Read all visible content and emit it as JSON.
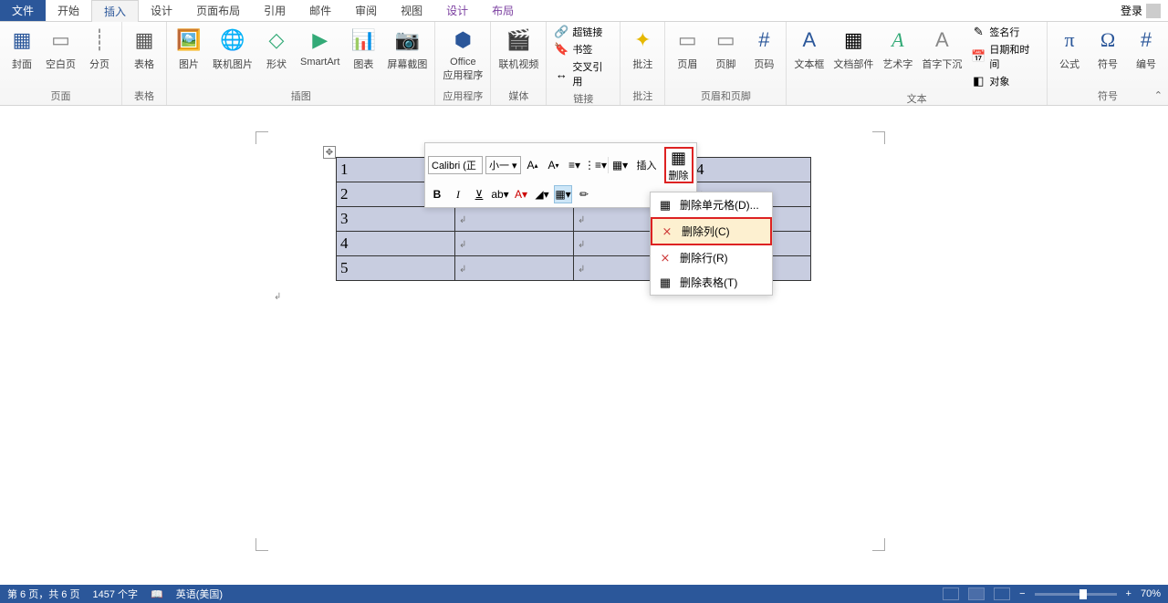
{
  "tabs": {
    "file": "文件",
    "home": "开始",
    "insert": "插入",
    "design": "设计",
    "layout": "页面布局",
    "ref": "引用",
    "mail": "邮件",
    "review": "审阅",
    "view": "视图",
    "tdesign": "设计",
    "tlayout": "布局"
  },
  "login": "登录",
  "ribbon": {
    "pages": {
      "cover": "封面",
      "blank": "空白页",
      "break": "分页",
      "label": "页面"
    },
    "tables": {
      "table": "表格",
      "label": "表格"
    },
    "illus": {
      "pic": "图片",
      "online": "联机图片",
      "shape": "形状",
      "smartart": "SmartArt",
      "chart": "图表",
      "screenshot": "屏幕截图",
      "label": "插图"
    },
    "apps": {
      "office": "Office\n应用程序",
      "label": "应用程序"
    },
    "media": {
      "video": "联机视频",
      "label": "媒体"
    },
    "links": {
      "hyper": "超链接",
      "bookmark": "书签",
      "xref": "交叉引用",
      "label": "链接"
    },
    "comments": {
      "comment": "批注",
      "label": "批注"
    },
    "hf": {
      "header": "页眉",
      "footer": "页脚",
      "pagenum": "页码",
      "label": "页眉和页脚"
    },
    "text": {
      "textbox": "文本框",
      "parts": "文档部件",
      "wordart": "艺术字",
      "dropcap": "首字下沉",
      "sig": "签名行",
      "dt": "日期和时间",
      "obj": "对象",
      "label": "文本"
    },
    "symbols": {
      "eq": "公式",
      "sym": "符号",
      "num": "编号",
      "label": "符号"
    }
  },
  "mini": {
    "font": "Calibri (正",
    "size": "小一",
    "insert": "插入",
    "delete": "删除"
  },
  "dropdown": {
    "cells": "删除单元格(D)...",
    "cols": "删除列(C)",
    "rows": "删除行(R)",
    "table": "删除表格(T)"
  },
  "table_rows": [
    "1",
    "2",
    "3",
    "4",
    "5"
  ],
  "col4": "4",
  "status": {
    "page": "第 6 页，共 6 页",
    "words": "1457 个字",
    "lang": "英语(美国)",
    "zoom": "70%"
  }
}
